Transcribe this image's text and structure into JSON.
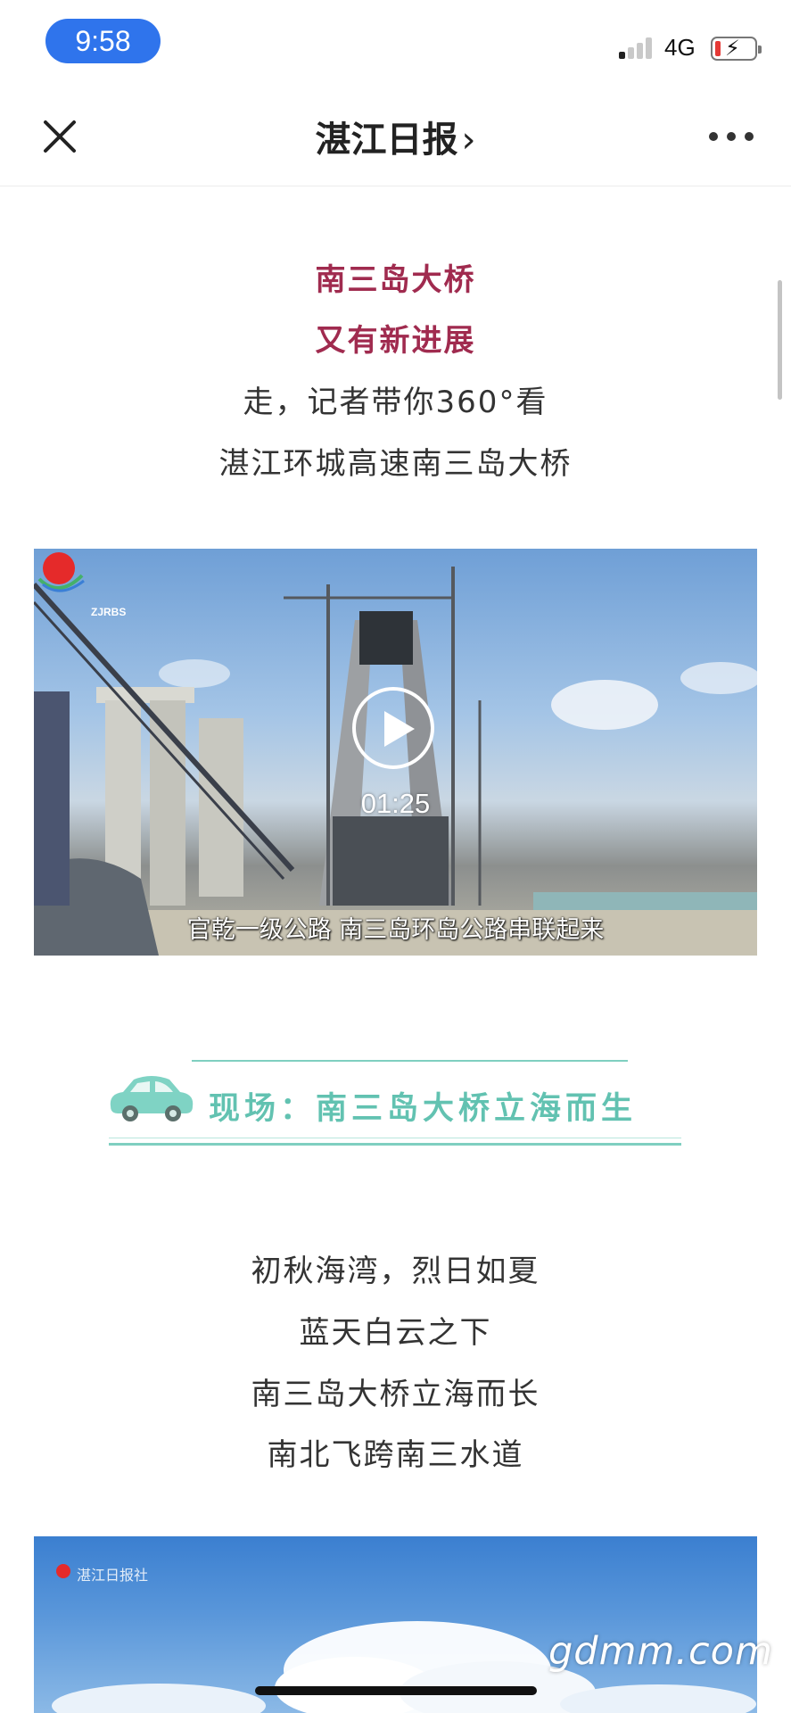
{
  "status_bar": {
    "time": "9:58",
    "network": "4G",
    "signal_bars_active": 1,
    "signal_bars_total": 4,
    "battery_level": 0.12,
    "battery_color": "#e53935",
    "time_pill_color": "#2f74ec"
  },
  "nav": {
    "title": "湛江日报",
    "title_chevron": "›",
    "close_icon": "close-icon",
    "more_icon": "more-dots-icon"
  },
  "article": {
    "headline_lines": [
      "南三岛大桥",
      "又有新进展"
    ],
    "intro_lines": [
      "走，记者带你360°看",
      "湛江环城高速南三岛大桥"
    ],
    "video": {
      "duration": "01:25",
      "subtitle": "官乾一级公路  南三岛环岛公路串联起来",
      "logo_text": "ZJRBS"
    },
    "section": {
      "title": "现场：南三岛大桥立海而生",
      "accent_color": "#62c2b1",
      "icon": "car-icon"
    },
    "body_lines": [
      "初秋海湾，烈日如夏",
      "蓝天白云之下",
      "南三岛大桥立海而长",
      "南北飞跨南三水道"
    ],
    "image2": {
      "mark": "湛江日报社"
    }
  },
  "watermark": "gdmm.com",
  "colors": {
    "headline": "#a02b4f",
    "body": "#333333"
  }
}
